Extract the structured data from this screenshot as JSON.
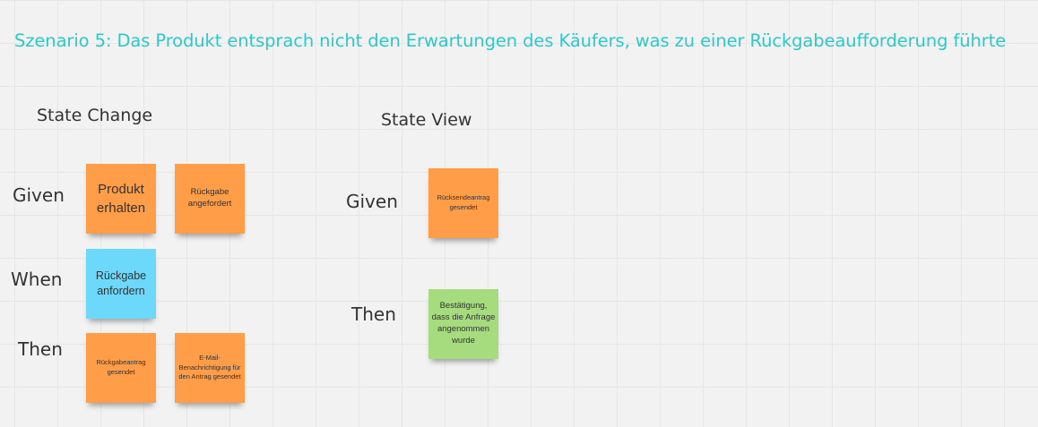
{
  "board": {
    "title": "Szenario 5: Das Produkt entsprach nicht den Erwartungen des Käufers, was zu einer Rückgabeaufforderung führte"
  },
  "state_change": {
    "heading": "State Change",
    "given_label": "Given",
    "when_label": "When",
    "then_label": "Then",
    "given_notes": [
      {
        "text": "Produkt erhalten",
        "color": "#ff9d48"
      },
      {
        "text": "Rückgabe angefordert",
        "color": "#ff9d48"
      }
    ],
    "when_notes": [
      {
        "text": "Rückgabe anfordern",
        "color": "#6cd8fa"
      }
    ],
    "then_notes": [
      {
        "text": "Rückgabeantrag gesendet",
        "color": "#ff9d48"
      },
      {
        "text": "E-Mail-Benachrichtigung für den Antrag gesendet",
        "color": "#ff9d48"
      }
    ]
  },
  "state_view": {
    "heading": "State View",
    "given_label": "Given",
    "then_label": "Then",
    "given_notes": [
      {
        "text": "Rücksendeantrag gesendet",
        "color": "#ff9d48"
      }
    ],
    "then_notes": [
      {
        "text": "Bestätigung, dass die Anfrage angenommen wurde",
        "color": "#a6dc7e"
      }
    ]
  }
}
